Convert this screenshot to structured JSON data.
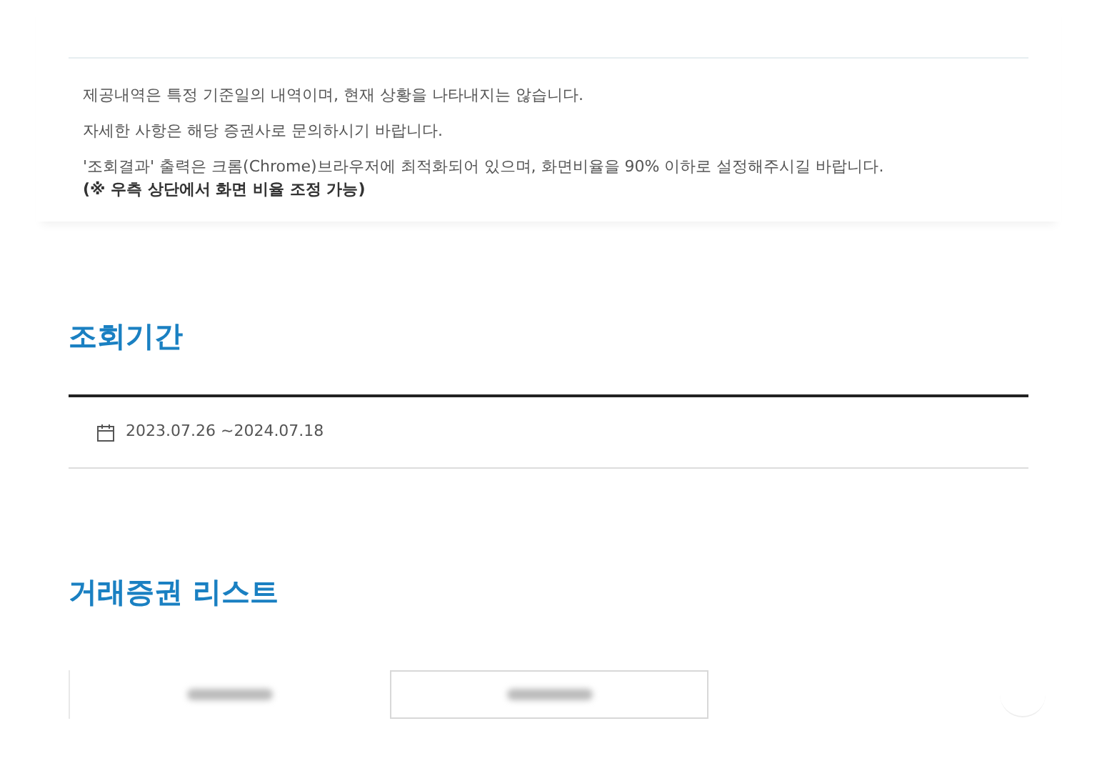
{
  "notice": {
    "lines": [
      "제공내역은 특정 기준일의 내역이며, 현재 상황을 나타내지는 않습니다.",
      "자세한 사항은 해당 증권사로 문의하시기 바랍니다.",
      "'조회결과' 출력은 크롬(Chrome)브라우저에 최적화되어 있으며, 화면비율을 90% 이하로 설정해주시길 바랍니다."
    ],
    "note": "(※ 우측 상단에서 화면 비율 조정 가능)"
  },
  "period": {
    "heading": "조회기간",
    "range": "2023.07.26 ~2024.07.18"
  },
  "securities": {
    "heading": "거래증권 리스트",
    "tabs": [
      {
        "selected": true
      },
      {
        "selected": false
      }
    ]
  }
}
